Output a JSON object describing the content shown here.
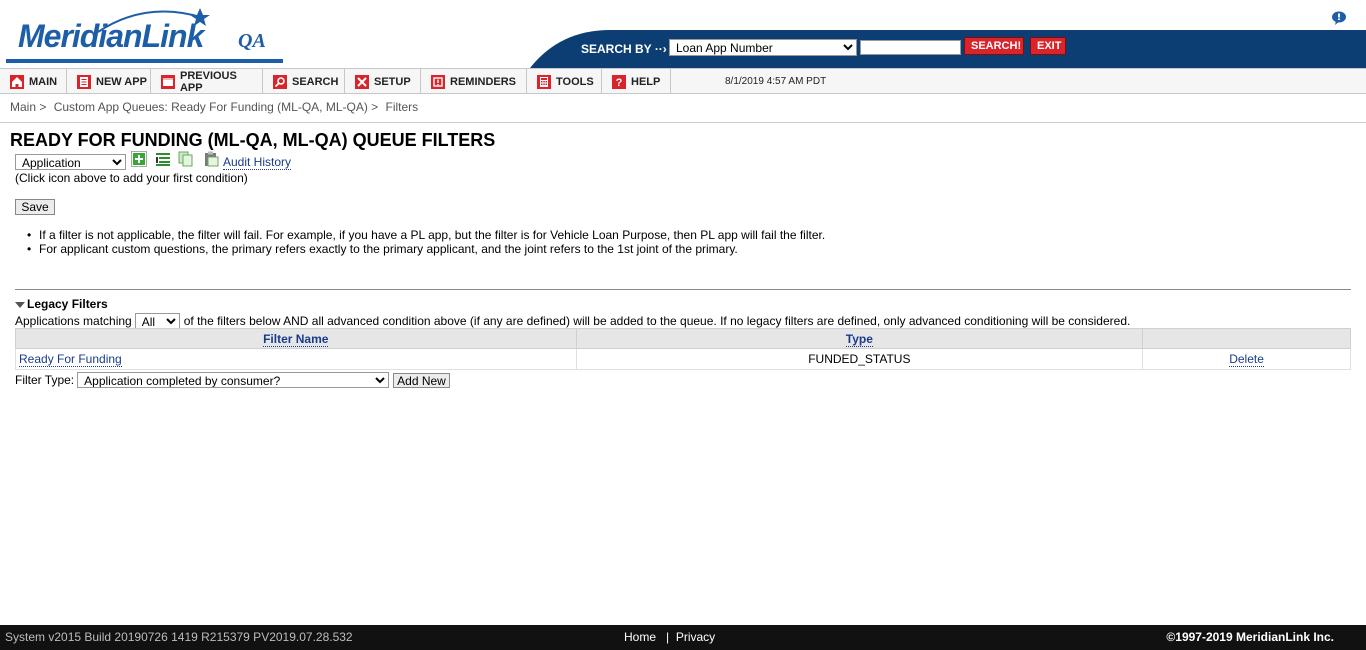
{
  "header": {
    "logo_text": "MeridianLink",
    "logo_suffix": "QA",
    "search_by_label": "SEARCH BY",
    "search_by_selected": "Loan App Number",
    "search_value": "",
    "search_button": "SEARCH!",
    "exit_button": "EXIT",
    "accent_blue": "#0d3e73",
    "button_red": "#d8242a"
  },
  "nav": {
    "items": [
      {
        "label": "MAIN",
        "icon": "home-icon"
      },
      {
        "label": "NEW APP",
        "icon": "new-app-icon"
      },
      {
        "label": "PREVIOUS APP",
        "icon": "previous-app-icon"
      },
      {
        "label": "SEARCH",
        "icon": "search-icon"
      },
      {
        "label": "SETUP",
        "icon": "setup-icon"
      },
      {
        "label": "REMINDERS",
        "icon": "reminders-icon"
      },
      {
        "label": "TOOLS",
        "icon": "tools-icon"
      },
      {
        "label": "HELP",
        "icon": "help-icon"
      }
    ],
    "datetime": "8/1/2019 4:57 AM PDT"
  },
  "breadcrumb": {
    "items": [
      "Main >",
      "Custom App Queues: Ready For Funding (ML-QA, ML-QA) >",
      "Filters"
    ]
  },
  "page": {
    "title": "READY FOR FUNDING (ML-QA, ML-QA) QUEUE FILTERS",
    "condition_selected": "Application",
    "audit_history": "Audit History",
    "hint": "(Click icon above to add your first condition)",
    "save_button": "Save",
    "notes": [
      "If a filter is not applicable, the filter will fail. For example, if you have a PL app, but the filter is for Vehicle Loan Purpose, then PL app will fail the filter.",
      "For applicant custom questions, the primary refers exactly to the primary applicant, and the joint refers to the 1st joint of the primary."
    ]
  },
  "legacy": {
    "title": "Legacy Filters",
    "matching_prefix": "Applications matching",
    "matching_selected": "All",
    "matching_suffix": "of the filters below AND all advanced condition above (if any are defined) will be added to the queue. If no legacy filters are defined, only advanced conditioning will be considered.",
    "columns": [
      "Filter Name",
      "Type",
      ""
    ],
    "rows": [
      {
        "name": "Ready For Funding",
        "type": "FUNDED_STATUS",
        "action": "Delete"
      }
    ],
    "filter_type_label": "Filter Type:",
    "filter_type_selected": "Application completed by consumer?",
    "add_new_button": "Add New"
  },
  "footer": {
    "version": "System v2015 Build 20190726 1419 R215379 PV2019.07.28.532",
    "home": "Home",
    "separator": "|",
    "privacy": "Privacy",
    "copyright": "©1997-2019 MeridianLink Inc."
  }
}
